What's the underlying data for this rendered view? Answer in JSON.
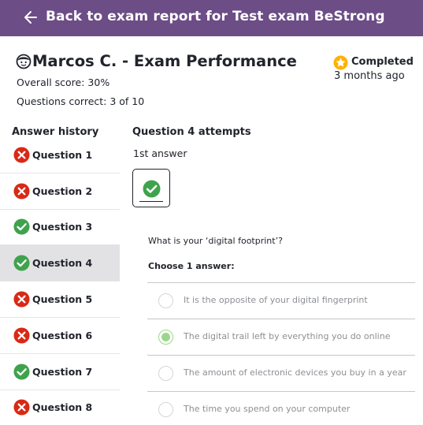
{
  "topbar": {
    "back_label": "Back to exam report for Test exam BeStrong",
    "background": "#6c4d86"
  },
  "header": {
    "title": "Marcos C. - Exam Performance",
    "overall_score": "Overall score: 30%",
    "questions_correct": "Questions correct: 3 of 10",
    "status_label": "Completed",
    "status_time": "3 months ago"
  },
  "sidebar": {
    "title": "Answer history",
    "items": [
      {
        "label": "Question 1",
        "result": "incorrect"
      },
      {
        "label": "Question 2",
        "result": "incorrect"
      },
      {
        "label": "Question 3",
        "result": "correct"
      },
      {
        "label": "Question 4",
        "result": "correct",
        "active": true
      },
      {
        "label": "Question 5",
        "result": "incorrect"
      },
      {
        "label": "Question 6",
        "result": "incorrect"
      },
      {
        "label": "Question 7",
        "result": "correct"
      },
      {
        "label": "Question 8",
        "result": "incorrect"
      }
    ]
  },
  "main": {
    "attempts_title": "Question 4 attempts",
    "answer_label": "1st answer",
    "question": "What is your ‘digital footprint’?",
    "choose_label": "Choose 1 answer:",
    "options": [
      {
        "text": "It is the opposite of your digital fingerprint",
        "selected": false
      },
      {
        "text": "The digital trail left by everything you do online",
        "selected": true
      },
      {
        "text": "The amount of electronic devices you buy in a year",
        "selected": false
      },
      {
        "text": "The time you spend on your computer",
        "selected": false
      }
    ]
  },
  "colors": {
    "correct": "#3fa34d",
    "incorrect": "#d92916",
    "star": "#ffb100",
    "selected_radio": "#9bd78a"
  },
  "icons": {
    "back": "arrow-left-icon",
    "avatar": "avatar-icon",
    "status": "star-icon",
    "correct": "check-circle-icon",
    "incorrect": "x-circle-icon"
  }
}
